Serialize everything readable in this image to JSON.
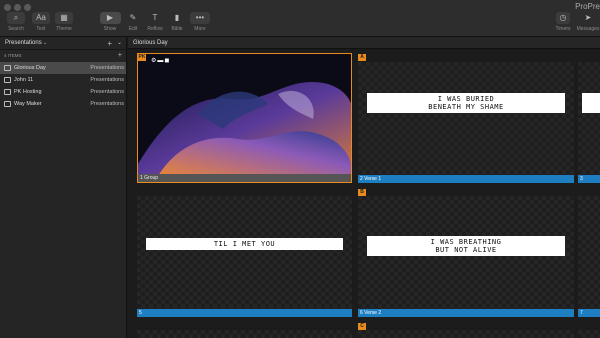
{
  "app": {
    "title": "ProPre"
  },
  "toolbar": {
    "left": [
      {
        "label": "Search",
        "icon": "search-icon",
        "glyph": "⌕"
      },
      {
        "label": "Text",
        "icon": "text-icon",
        "glyph": "Aa"
      },
      {
        "label": "Theme",
        "icon": "theme-icon",
        "glyph": "▦"
      }
    ],
    "center": [
      {
        "label": "Show",
        "icon": "show-icon",
        "glyph": "▶"
      },
      {
        "label": "Edit",
        "icon": "edit-icon",
        "glyph": "✎"
      },
      {
        "label": "Reflow",
        "icon": "reflow-icon",
        "glyph": "T"
      },
      {
        "label": "Bible",
        "icon": "bible-icon",
        "glyph": "▮"
      },
      {
        "label": "More",
        "icon": "more-icon",
        "glyph": "•••"
      }
    ],
    "right": [
      {
        "label": "Timers",
        "icon": "timer-icon",
        "glyph": "◷"
      },
      {
        "label": "Messages",
        "icon": "messages-icon",
        "glyph": "➤"
      }
    ]
  },
  "sidebar": {
    "header": "Presentations",
    "count": "4 ITEMS",
    "items": [
      {
        "name": "Glorious Day",
        "type": "Presentations",
        "selected": true
      },
      {
        "name": "John 11",
        "type": "Presentations",
        "selected": false
      },
      {
        "name": "PK Hosting",
        "type": "Presentations",
        "selected": false
      },
      {
        "name": "Way Maker",
        "type": "Presentations",
        "selected": false
      }
    ]
  },
  "document": {
    "title": "Glorious Day"
  },
  "slides": [
    {
      "number": "1",
      "label": "1 Group",
      "group_badge": "",
      "text": "",
      "bar": "grey",
      "cover": true
    },
    {
      "number": "2",
      "label": "2 Verse 1",
      "group_badge": "A",
      "text": "I WAS BURIED\nBENEATH MY SHAME",
      "bar": "blue"
    },
    {
      "number": "3",
      "label": "3",
      "group_badge": "",
      "text": "",
      "bar": "blue"
    },
    {
      "number": "5",
      "label": "5",
      "group_badge": "",
      "text": "TIL I MET YOU",
      "bar": "blue"
    },
    {
      "number": "6",
      "label": "6 Verse 2",
      "group_badge": "B",
      "text": "I WAS BREATHING\nBUT NOT ALIVE",
      "bar": "blue"
    },
    {
      "number": "7",
      "label": "7",
      "group_badge": "",
      "text": "",
      "bar": "blue"
    },
    {
      "number": "",
      "label": "",
      "group_badge": "C",
      "text": "",
      "bar": ""
    }
  ],
  "cover_badge": "PK",
  "colors": {
    "accent": "#e98b1e",
    "label_blue": "#1d7fc1"
  }
}
